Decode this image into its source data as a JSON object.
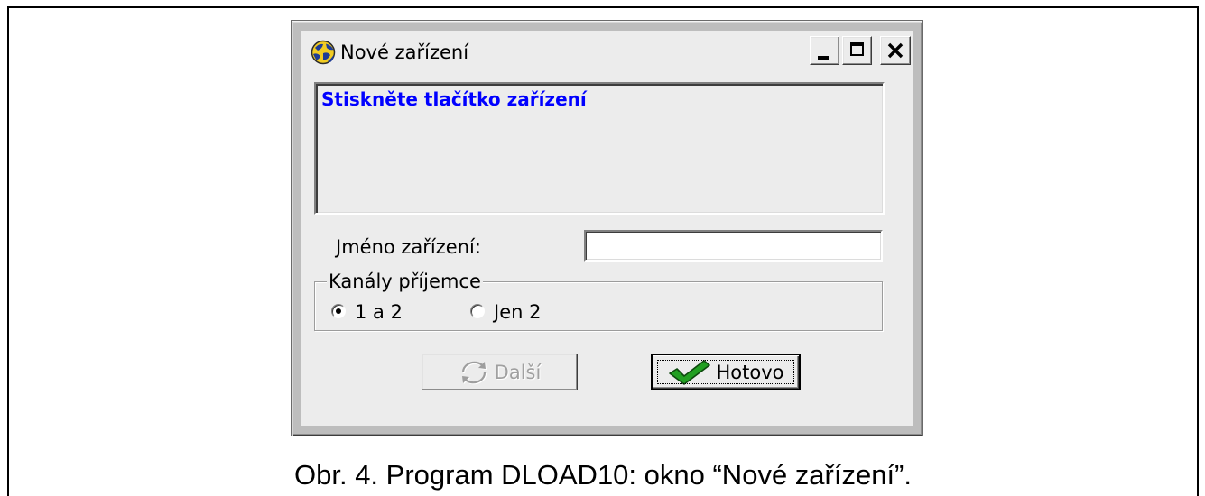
{
  "window": {
    "title": "Nové zařízení",
    "icon": "app-globe-icon",
    "controls": [
      "minimize-icon",
      "maximize-icon",
      "close-icon"
    ]
  },
  "message": {
    "text": "Stiskněte tlačítko zařízení"
  },
  "device_name": {
    "label": "Jméno zařízení:",
    "value": ""
  },
  "channels": {
    "legend": "Kanály příjemce",
    "options": [
      {
        "label": "1 a 2",
        "selected": true
      },
      {
        "label": "Jen 2",
        "selected": false
      }
    ]
  },
  "actions": {
    "next": {
      "label": "Další",
      "icon": "refresh-icon",
      "enabled": false
    },
    "done": {
      "label": "Hotovo",
      "icon": "checkmark-icon",
      "enabled": true,
      "default": true
    }
  },
  "figure": {
    "caption": "Obr. 4. Program DLOAD10: okno “Nové zařízení”."
  },
  "colors": {
    "dialog_background": "#ECECEC",
    "window_frame": "#BDBDBD",
    "message_text": "#0000FF",
    "check_green": "#22A022",
    "disabled_text": "#A0A0A0"
  }
}
